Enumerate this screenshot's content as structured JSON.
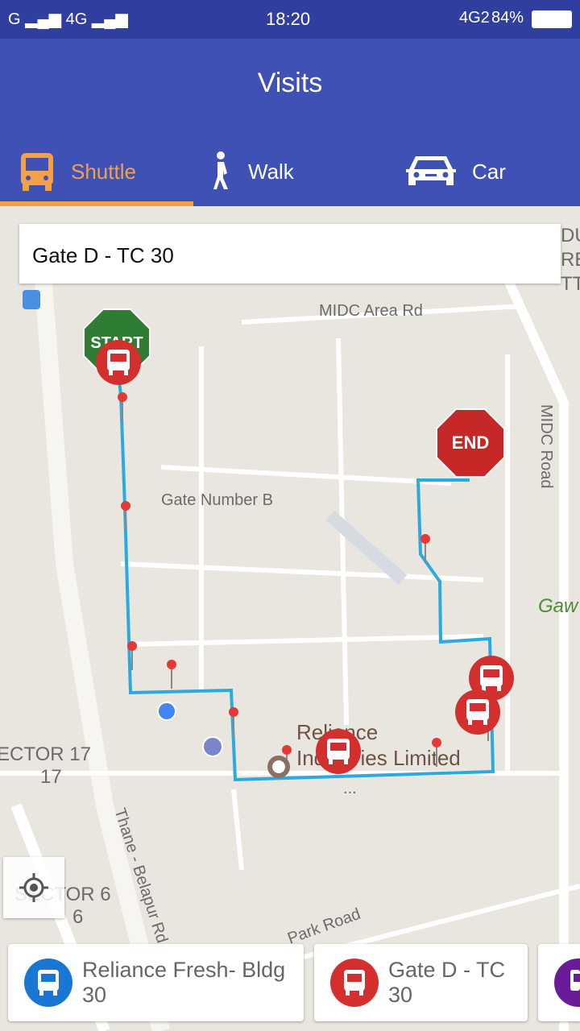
{
  "status_bar": {
    "left": "G ▂▄▆ 4G ▂▄▆",
    "time": "18:20",
    "network": "4G2",
    "battery": "84%"
  },
  "header": {
    "title": "Visits"
  },
  "tabs": [
    {
      "label": "Shuttle",
      "icon": "bus-icon",
      "active": true
    },
    {
      "label": "Walk",
      "icon": "walk-icon"
    },
    {
      "label": "Car",
      "icon": "car-icon"
    }
  ],
  "colors": {
    "primary": "#3f51b5",
    "status": "#303f9f",
    "accent": "#f2a04a",
    "route": "#29abe2",
    "stop_red": "#d32f2f",
    "stop_blue": "#1976d2",
    "stop_purple": "#6a1b9a"
  },
  "search": {
    "value": "Gate D - TC 30"
  },
  "map": {
    "labels": {
      "midc_area_rd": "MIDC Area Rd",
      "gate_b": "Gate Number B",
      "midc_road": "MIDC Road",
      "gaw": "Gaw",
      "reliance1": "Reliance",
      "reliance2": "Industries Limited",
      "sector17a": "ECTOR 17",
      "sector17b": "17",
      "sector6a": "SECTOR 6",
      "sector6b": "6",
      "thane": "Thane - Belapur Rd",
      "park": "Park Road",
      "dots": "...",
      "du": "DU",
      "re": "RE",
      "tt": "TT"
    },
    "start_label": "START",
    "end_label": "END"
  },
  "stops": [
    {
      "name": "Reliance Fresh- Bldg 30",
      "color": "#1976d2"
    },
    {
      "name": "Gate D - TC 30",
      "color": "#d32f2f"
    },
    {
      "name": "",
      "color": "#6a1b9a"
    }
  ]
}
